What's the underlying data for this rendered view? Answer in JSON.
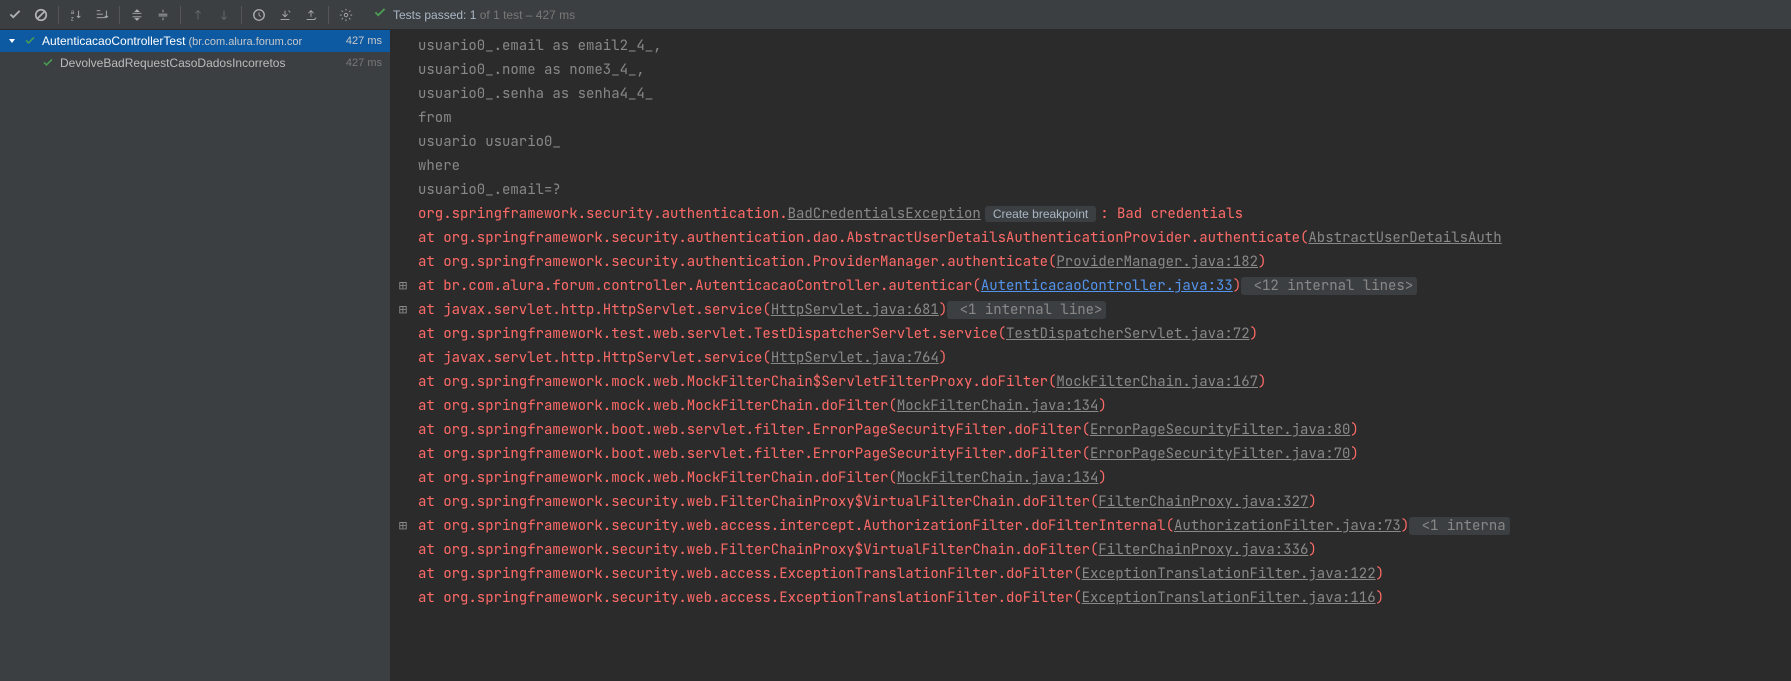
{
  "toolbar": {
    "status_prefix": "Tests passed: ",
    "status_num": "1",
    "status_suffix": " of 1 test – 427 ms"
  },
  "tree": {
    "root": {
      "label": "AutenticacaoControllerTest",
      "suffix": " (br.com.alura.forum.cor",
      "time": "427 ms"
    },
    "child": {
      "label": "DevolveBadRequestCasoDadosIncorretos",
      "time": "427 ms"
    }
  },
  "console": {
    "sql1": "        usuario0_.email as email2_4_,",
    "sql2": "        usuario0_.nome as nome3_4_,",
    "sql3": "        usuario0_.senha as senha4_4_ ",
    "sql4": "    from",
    "sql5": "        usuario usuario0_ ",
    "sql6": "    where",
    "sql7": "        usuario0_.email=?",
    "exc_pre": "org.springframework.security.authentication.",
    "exc_link": "BadCredentialsException",
    "exc_btn": "Create breakpoint",
    "exc_msg": ": Bad credentials",
    "st1_a": "\tat org.springframework.security.authentication.dao.AbstractUserDetailsAuthenticationProvider.authenticate(",
    "st1_l": "AbstractUserDetailsAuth",
    "st2_a": "\tat org.springframework.security.authentication.ProviderManager.authenticate(",
    "st2_l": "ProviderManager.java:182",
    "st3_a": "\tat br.com.alura.forum.controller.AutenticacaoController.autenticar(",
    "st3_l": "AutenticacaoController.java:33",
    "st3_x": " <12 internal lines>",
    "st4_a": "\tat javax.servlet.http.HttpServlet.service(",
    "st4_l": "HttpServlet.java:681",
    "st4_x": " <1 internal line>",
    "st5_a": "\tat org.springframework.test.web.servlet.TestDispatcherServlet.service(",
    "st5_l": "TestDispatcherServlet.java:72",
    "st6_a": "\tat javax.servlet.http.HttpServlet.service(",
    "st6_l": "HttpServlet.java:764",
    "st7_a": "\tat org.springframework.mock.web.MockFilterChain$ServletFilterProxy.doFilter(",
    "st7_l": "MockFilterChain.java:167",
    "st8_a": "\tat org.springframework.mock.web.MockFilterChain.doFilter(",
    "st8_l": "MockFilterChain.java:134",
    "st9_a": "\tat org.springframework.boot.web.servlet.filter.ErrorPageSecurityFilter.doFilter(",
    "st9_l": "ErrorPageSecurityFilter.java:80",
    "st10_a": "\tat org.springframework.boot.web.servlet.filter.ErrorPageSecurityFilter.doFilter(",
    "st10_l": "ErrorPageSecurityFilter.java:70",
    "st11_a": "\tat org.springframework.mock.web.MockFilterChain.doFilter(",
    "st11_l": "MockFilterChain.java:134",
    "st12_a": "\tat org.springframework.security.web.FilterChainProxy$VirtualFilterChain.doFilter(",
    "st12_l": "FilterChainProxy.java:327",
    "st13_a": "\tat org.springframework.security.web.access.intercept.AuthorizationFilter.doFilterInternal(",
    "st13_l": "AuthorizationFilter.java:73",
    "st13_x": " <1 interna",
    "st14_a": "\tat org.springframework.security.web.FilterChainProxy$VirtualFilterChain.doFilter(",
    "st14_l": "FilterChainProxy.java:336",
    "st15_a": "\tat org.springframework.security.web.access.ExceptionTranslationFilter.doFilter(",
    "st15_l": "ExceptionTranslationFilter.java:122",
    "st16_a": "\tat org.springframework.security.web.access.ExceptionTranslationFilter.doFilter(",
    "st16_l": "ExceptionTranslationFilter.java:116"
  }
}
